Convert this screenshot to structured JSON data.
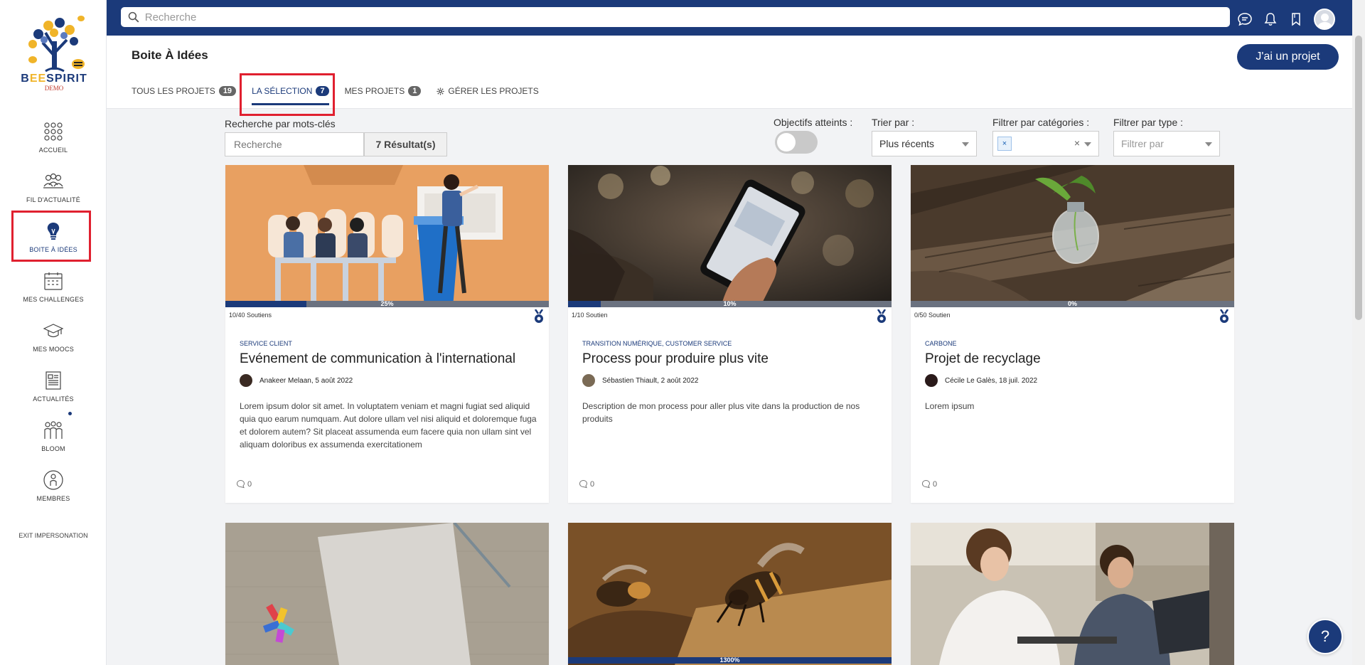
{
  "brand": {
    "name_part1": "B",
    "name_e1": "E",
    "name_e2": "E",
    "name_part2": "SPIRIT",
    "sub": "DEMO"
  },
  "topbar": {
    "search_placeholder": "Recherche"
  },
  "sidebar": {
    "items": [
      {
        "label": "ACCUEIL",
        "icon": "grid-dots-icon"
      },
      {
        "label": "FIL D'ACTUALITÉ",
        "icon": "people-icon"
      },
      {
        "label": "BOITE À IDÉES",
        "icon": "lightbulb-icon",
        "active": true
      },
      {
        "label": "MES CHALLENGES",
        "icon": "calendar-icon"
      },
      {
        "label": "MES MOOCS",
        "icon": "graduation-cap-icon"
      },
      {
        "label": "ACTUALITÉS",
        "icon": "newspaper-icon"
      },
      {
        "label": "BLOOM",
        "icon": "group-icon"
      },
      {
        "label": "MEMBRES",
        "icon": "member-icon"
      }
    ],
    "exit": "EXIT IMPERSONATION"
  },
  "header": {
    "title": "Boite À Idées",
    "cta": "J'ai un projet",
    "tabs": [
      {
        "label": "TOUS LES PROJETS",
        "count": "19"
      },
      {
        "label": "LA SÉLECTION",
        "count": "7",
        "active": true
      },
      {
        "label": "MES PROJETS",
        "count": "1"
      },
      {
        "label": "GÉRER LES PROJETS"
      }
    ]
  },
  "filters": {
    "keyword_label": "Recherche par mots-clés",
    "keyword_placeholder": "Recherche",
    "results": "7 Résultat(s)",
    "objectives_label": "Objectifs atteints :",
    "sort_label": "Trier par :",
    "sort_value": "Plus récents",
    "category_label": "Filtrer par catégories :",
    "category_chip": "×",
    "category_clear": "×",
    "type_label": "Filtrer par type :",
    "type_placeholder": "Filtrer par"
  },
  "cards": [
    {
      "supports": "10/40 Soutiens",
      "progress": 25,
      "progress_label": "25%",
      "category": "SERVICE CLIENT",
      "title": "Evénement de communication à l'international",
      "author": "Anakeer Melaan",
      "date": " , 5 août 2022",
      "desc": "Lorem ipsum dolor sit amet. In voluptatem veniam et magni fugiat sed aliquid quia quo earum numquam. Aut dolore ullam vel nisi aliquid et doloremque fuga et dolorem autem? Sit placeat assumenda eum facere quia non ullam sint vel aliquam doloribus ex assumenda exercitationem",
      "comments": "0"
    },
    {
      "supports": "1/10 Soutien",
      "progress": 10,
      "progress_label": "10%",
      "category": "TRANSITION NUMÉRIQUE, CUSTOMER SERVICE",
      "title": "Process pour produire plus vite",
      "author": "Sébastien Thiault",
      "date": " , 2 août 2022",
      "desc": "Description de mon process pour aller plus vite dans la production de nos produits",
      "comments": "0"
    },
    {
      "supports": "0/50 Soutien",
      "progress": 0,
      "progress_label": "0%",
      "category": "CARBONE",
      "title": "Projet de recyclage",
      "author": "Cécile Le Galès",
      "date": " , 18 juil. 2022",
      "desc": "Lorem ipsum",
      "comments": "0"
    },
    {
      "progress_label": ""
    },
    {
      "progress": 100,
      "progress_label": "1300%"
    },
    {
      "progress_label": ""
    }
  ],
  "colors": {
    "primary": "#1b3a7a",
    "highlight": "#e0202f",
    "accent": "#f0b429"
  },
  "help": "?"
}
